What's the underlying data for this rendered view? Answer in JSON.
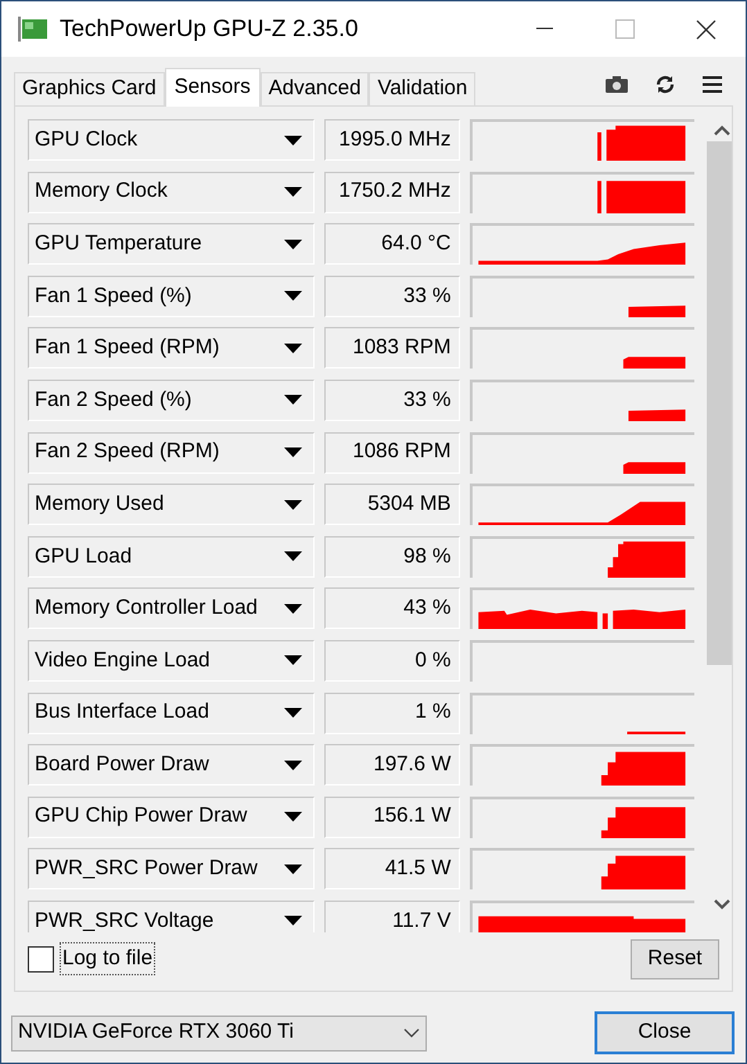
{
  "window": {
    "title": "TechPowerUp GPU-Z 2.35.0"
  },
  "tabs": [
    {
      "label": "Graphics Card",
      "selected": false
    },
    {
      "label": "Sensors",
      "selected": true
    },
    {
      "label": "Advanced",
      "selected": false
    },
    {
      "label": "Validation",
      "selected": false
    }
  ],
  "sensors": [
    {
      "name": "GPU Clock",
      "value": "1995.0 MHz"
    },
    {
      "name": "Memory Clock",
      "value": "1750.2 MHz"
    },
    {
      "name": "GPU Temperature",
      "value": "64.0 °C"
    },
    {
      "name": "Fan 1 Speed (%)",
      "value": "33 %"
    },
    {
      "name": "Fan 1 Speed (RPM)",
      "value": "1083 RPM"
    },
    {
      "name": "Fan 2 Speed (%)",
      "value": "33 %"
    },
    {
      "name": "Fan 2 Speed (RPM)",
      "value": "1086 RPM"
    },
    {
      "name": "Memory Used",
      "value": "5304 MB"
    },
    {
      "name": "GPU Load",
      "value": "98 %"
    },
    {
      "name": "Memory Controller Load",
      "value": "43 %"
    },
    {
      "name": "Video Engine Load",
      "value": "0 %"
    },
    {
      "name": "Bus Interface Load",
      "value": "1 %"
    },
    {
      "name": "Board Power Draw",
      "value": "197.6 W"
    },
    {
      "name": "GPU Chip Power Draw",
      "value": "156.1 W"
    },
    {
      "name": "PWR_SRC Power Draw",
      "value": "41.5 W"
    },
    {
      "name": "PWR_SRC Voltage",
      "value": "11.7 V"
    }
  ],
  "log_to_file": {
    "label": "Log to file",
    "checked": false
  },
  "reset_button": "Reset",
  "gpu_select": {
    "value": "NVIDIA GeForce RTX 3060 Ti"
  },
  "close_button": "Close"
}
